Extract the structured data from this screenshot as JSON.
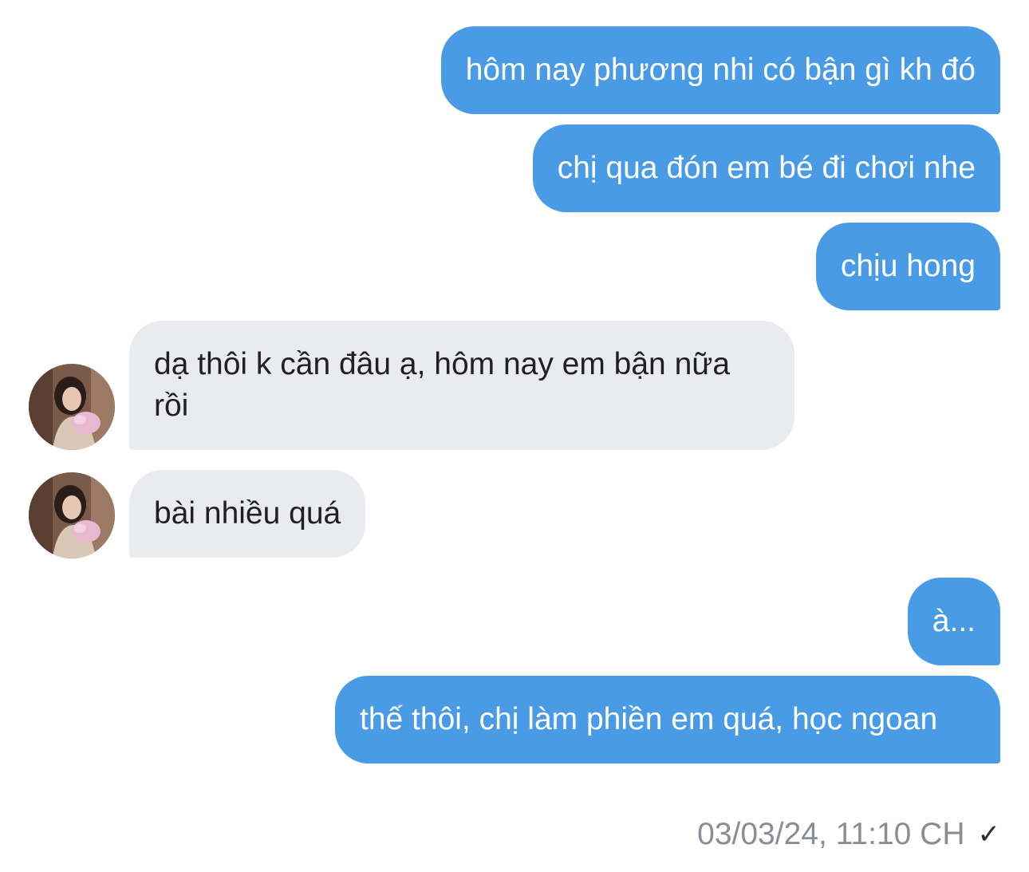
{
  "conversation": {
    "messages": [
      {
        "direction": "outgoing",
        "text": "hôm nay phương nhi có bận gì kh đó"
      },
      {
        "direction": "outgoing",
        "text": "chị qua đón em bé đi chơi nhe"
      },
      {
        "direction": "outgoing",
        "text": "chịu hong"
      },
      {
        "direction": "incoming",
        "text": "dạ thôi k cần đâu ạ, hôm nay em bận nữa rồi"
      },
      {
        "direction": "incoming",
        "text": "bài nhiều quá"
      },
      {
        "direction": "outgoing",
        "text": "à..."
      },
      {
        "direction": "outgoing",
        "text": "thế thôi, chị làm phiền em quá, học ngoan"
      }
    ],
    "timestamp": "03/03/24, 11:10 CH",
    "status_icon": "checkmark-icon"
  },
  "colors": {
    "outgoing_bubble": "#4a9be6",
    "incoming_bubble": "#e9ebef",
    "timestamp": "#8a8d93"
  }
}
